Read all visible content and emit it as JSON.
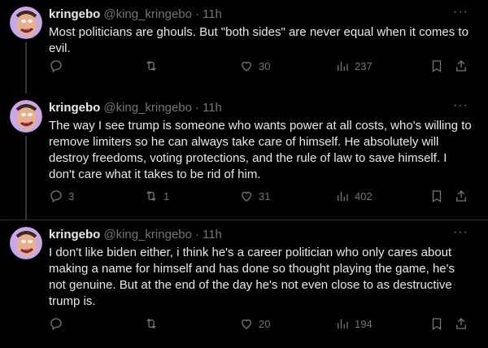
{
  "tweets": [
    {
      "name": "kringebo",
      "handle": "@king_kringebo",
      "time": "11h",
      "text": "Most politicians are ghouls. But \"both sides\" are never equal when it comes to evil.",
      "replies": "",
      "retweets": "",
      "likes": "30",
      "views": "237"
    },
    {
      "name": "kringebo",
      "handle": "@king_kringebo",
      "time": "11h",
      "text": "The way I see trump is someone who wants power at all costs, who's willing to remove limiters so he can always take care of himself. He absolutely will destroy freedoms, voting protections, and the rule of law to save himself. I don't care what it takes to be rid of him.",
      "replies": "3",
      "retweets": "1",
      "likes": "31",
      "views": "402"
    },
    {
      "name": "kringebo",
      "handle": "@king_kringebo",
      "time": "11h",
      "text": "I don't like biden either, i think he's a career politician who only cares about making a name for himself and has done so thought playing the game, he's not genuine. But at the end of the day he's not even close to as destructive trump is.",
      "replies": "",
      "retweets": "",
      "likes": "20",
      "views": "194"
    }
  ],
  "dot": "·",
  "more": "···",
  "icons": [
    "avatar-cartoon",
    "reply-icon",
    "retweet-icon",
    "like-icon",
    "views-icon",
    "bookmark-icon",
    "share-icon",
    "more-icon"
  ],
  "colors": {
    "background": "#000000",
    "text": "#e7e9ea",
    "muted": "#71767b",
    "divider": "#2f3336"
  }
}
